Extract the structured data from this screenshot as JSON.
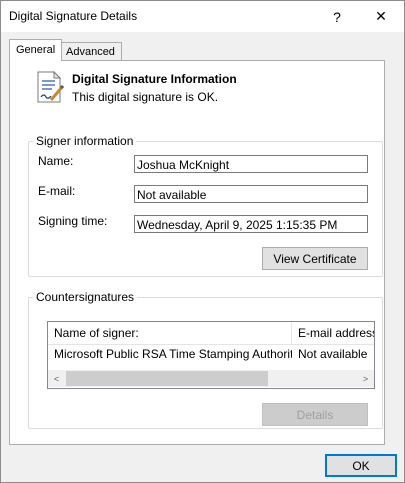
{
  "window": {
    "title": "Digital Signature Details",
    "help_glyph": "?",
    "close_glyph": "✕"
  },
  "tabs": [
    {
      "label": "General",
      "selected": true
    },
    {
      "label": "Advanced",
      "selected": false
    }
  ],
  "info": {
    "heading": "Digital Signature Information",
    "status": "This digital signature is OK.",
    "icon": "signed-document-icon"
  },
  "signer": {
    "group_label": "Signer information",
    "name_label": "Name:",
    "name_value": "Joshua McKnight",
    "email_label": "E-mail:",
    "email_value": "Not available",
    "time_label": "Signing time:",
    "time_value": "Wednesday, April 9, 2025 1:15:35 PM",
    "view_cert_label": "View Certificate"
  },
  "countersignatures": {
    "group_label": "Countersignatures",
    "columns": [
      "Name of signer:",
      "E-mail address:"
    ],
    "rows": [
      [
        "Microsoft Public RSA Time Stamping Authority",
        "Not available"
      ]
    ],
    "scroll_left": "<",
    "scroll_right": ">",
    "details_label": "Details"
  },
  "footer": {
    "ok_label": "OK"
  },
  "colors": {
    "accent": "#0078d7",
    "panel_bg": "#ffffff",
    "window_bg": "#f0f0f0"
  }
}
